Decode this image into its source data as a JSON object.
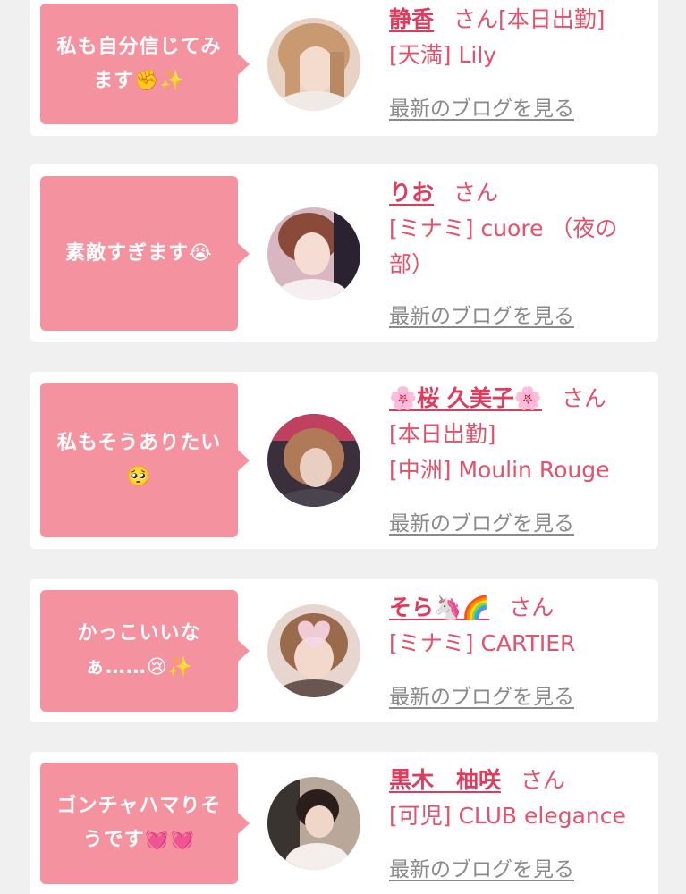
{
  "colors": {
    "bubble": "#f5929f",
    "accent": "#e03b5d",
    "link_gray": "#8a8a8a",
    "background": "#f0f0f0",
    "card": "#ffffff"
  },
  "san_label": "さん",
  "blog_link": "最新のブログを見る",
  "items": [
    {
      "comment": "私も自分信じてみます✊✨",
      "name": "静香",
      "tags": "[本日出勤]",
      "shop": "[天満] Lily",
      "avatar_icon": "avatar-photo-icon"
    },
    {
      "comment": "素敵すぎます😭",
      "name": "りお",
      "tags": "",
      "shop": "[ミナミ] cuore （夜の部）",
      "avatar_icon": "avatar-photo-icon"
    },
    {
      "comment": "私もそうありたい🥺",
      "name": "🌸桜 久美子🌸",
      "tags": "[本日出勤]",
      "shop": "[中洲] Moulin Rouge",
      "avatar_icon": "avatar-photo-icon"
    },
    {
      "comment": "かっこいいなぁ……😢✨",
      "name": "そら🦄🌈",
      "tags": "",
      "shop": "[ミナミ] CARTIER",
      "avatar_icon": "avatar-photo-icon"
    },
    {
      "comment": "ゴンチャハマりそうです💓💓",
      "name": "黒木　柚咲",
      "tags": "",
      "shop": "[可児] CLUB elegance",
      "avatar_icon": "avatar-photo-icon"
    }
  ]
}
